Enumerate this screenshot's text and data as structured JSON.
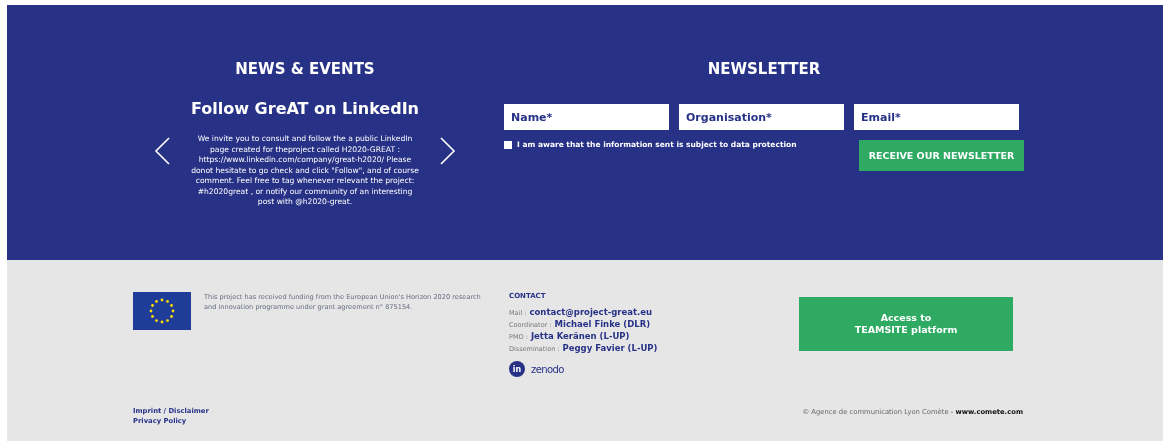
{
  "news": {
    "heading": "NEWS & EVENTS",
    "slide_title": "Follow GreAT on LinkedIn",
    "slide_text": "We invite you to consult and follow the a public LinkedIn page created for theproject called H2020-GREAT : https://www.linkedin.com/company/great-h2020/ Please donot hesitate to go check and click \"Follow\", and of course comment.   Feel free to tag whenever relevant the project: #h2020great , or notify our community of an interesting post with @h2020-great."
  },
  "newsletter": {
    "heading": "NEWSLETTER",
    "fields": [
      {
        "placeholder": "Name*"
      },
      {
        "placeholder": "Organisation*"
      },
      {
        "placeholder": "Email*"
      }
    ],
    "consent": {
      "label": "I am aware that the information sent is subject to data protection",
      "checked": false
    },
    "submit": "RECEIVE OUR NEWSLETTER"
  },
  "footer": {
    "funding": "This project has received funding from the European Union's Horizon 2020 research and innovation programme under grant agreement n° 875154.",
    "contact": {
      "heading": "CONTACT",
      "rows": [
        {
          "label": "Mail :",
          "value": "contact@project-great.eu"
        },
        {
          "label": "Coordinator :",
          "value": "Michael Finke (DLR)"
        },
        {
          "label": "PMO :",
          "value": "Jetta Keränen (L-UP)"
        },
        {
          "label": "Dissemination :",
          "value": "Peggy Favier (L-UP)"
        }
      ],
      "socials": [
        {
          "kind": "badge",
          "label": "in"
        },
        {
          "kind": "wordmark",
          "label": "zenodo"
        }
      ]
    },
    "teamsite_button": [
      "Access to",
      "TEAMSITE platform"
    ],
    "links": [
      "Imprint / Disclaimer",
      "Privacy Policy"
    ],
    "copyright": "© Agence de communication Lyon Comète - **www.comete.com**"
  }
}
